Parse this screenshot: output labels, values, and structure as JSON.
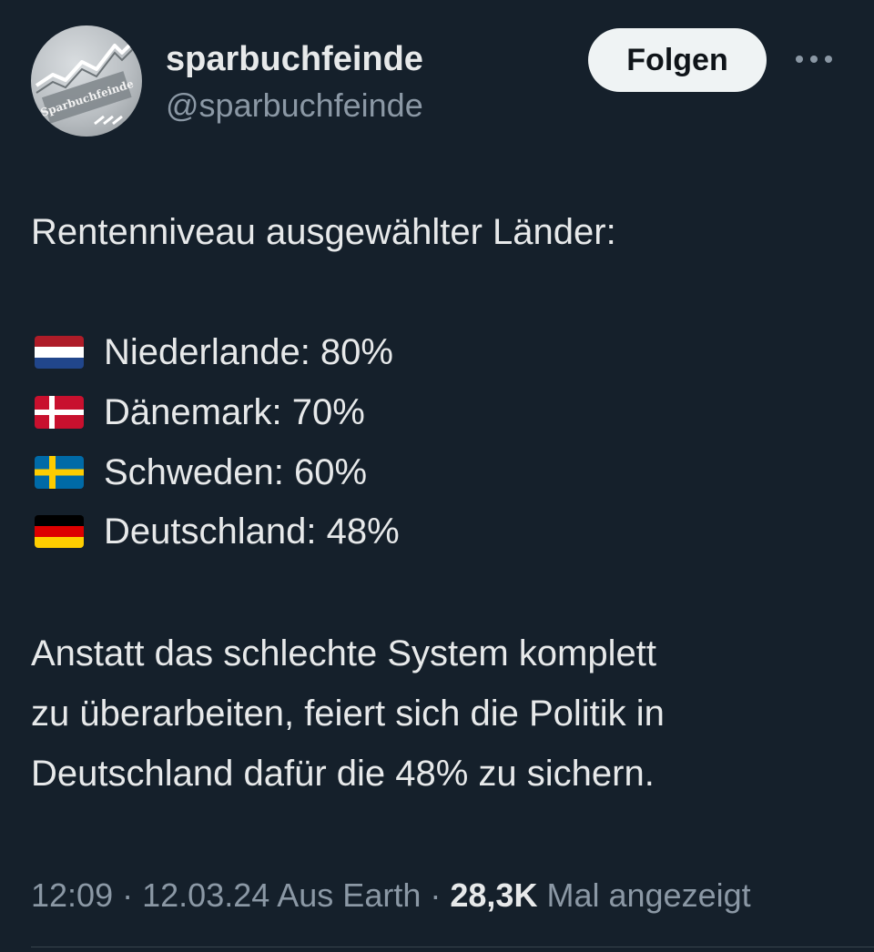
{
  "author": {
    "display_name": "sparbuchfeinde",
    "handle": "@sparbuchfeinde",
    "avatar_text": "Sparbuchfeinde"
  },
  "actions": {
    "follow_label": "Folgen",
    "more_icon": "more-horizontal-icon"
  },
  "tweet": {
    "intro": "Rentenniveau ausgewählter Länder:",
    "countries": [
      {
        "flag": "netherlands-flag",
        "text": "Niederlande: 80%"
      },
      {
        "flag": "denmark-flag",
        "text": "Dänemark: 70%"
      },
      {
        "flag": "sweden-flag",
        "text": "Schweden: 60%"
      },
      {
        "flag": "germany-flag",
        "text": "Deutschland: 48%"
      }
    ],
    "paragraph_lines": [
      "Anstatt das schlechte System komplett",
      "zu überarbeiten, feiert sich die Politik in",
      "Deutschland dafür die 48% zu sichern."
    ]
  },
  "meta": {
    "time": "12:09",
    "separator": "·",
    "date_location": "12.03.24 Aus Earth",
    "views_count": "28,3K",
    "views_label": "Mal angezeigt"
  },
  "colors": {
    "background": "#15202b",
    "text": "#e7e9ea",
    "secondary_text": "#8b98a5",
    "follow_button_bg": "#eff3f4"
  }
}
